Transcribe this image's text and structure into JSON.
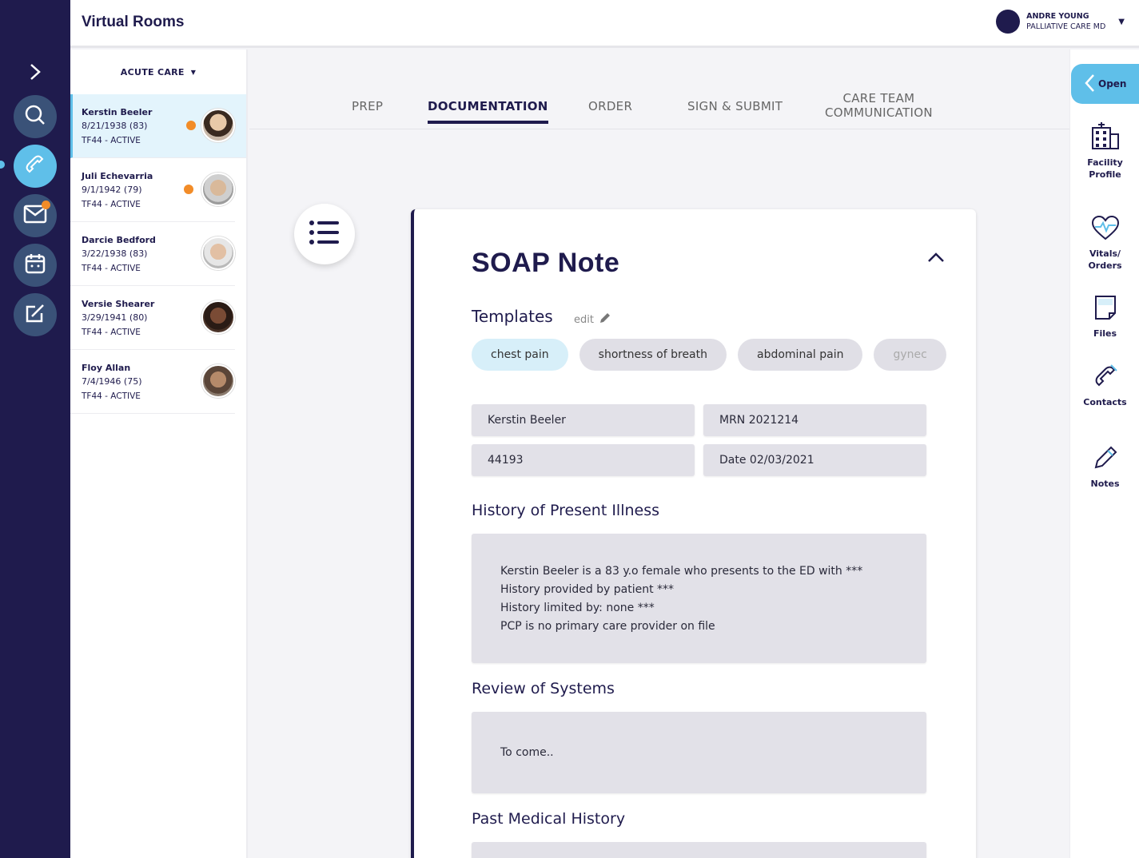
{
  "app": {
    "title": "Virtual Rooms"
  },
  "user": {
    "name": "ANDRE YOUNG",
    "role": "PALLIATIVE CARE MD"
  },
  "rail": {
    "icons": [
      "chevron-right-icon",
      "search-icon",
      "phone-icon",
      "mail-icon",
      "calendar-icon",
      "edit-icon"
    ]
  },
  "patient_list": {
    "filter_label": "ACUTE CARE",
    "patients": [
      {
        "name": "Kerstin Beeler",
        "dob": "8/21/1938 (83)",
        "status": "TF44 - ACTIVE"
      },
      {
        "name": "Juli Echevarria",
        "dob": "9/1/1942 (79)",
        "status": "TF44 - ACTIVE"
      },
      {
        "name": "Darcie Bedford",
        "dob": "3/22/1938 (83)",
        "status": "TF44 - ACTIVE"
      },
      {
        "name": "Versie Shearer",
        "dob": "3/29/1941 (80)",
        "status": "TF44 - ACTIVE"
      },
      {
        "name": "Floy Allan",
        "dob": "7/4/1946 (75)",
        "status": "TF44 - ACTIVE"
      }
    ]
  },
  "tabs": [
    {
      "label": "PREP"
    },
    {
      "label": "DOCUMENTATION"
    },
    {
      "label": "ORDER"
    },
    {
      "label": "SIGN & SUBMIT"
    },
    {
      "label_line1": "CARE TEAM",
      "label_line2": "COMMUNICATION"
    }
  ],
  "soap": {
    "title": "SOAP Note",
    "templates_label": "Templates",
    "edit_label": "edit",
    "templates": [
      "chest pain",
      "shortness of breath",
      "abdominal pain",
      "gynec"
    ],
    "fields": {
      "patient_name": "Kerstin Beeler",
      "mrn": "MRN 2021214",
      "zip": "44193",
      "date": "Date 02/03/2021"
    },
    "hpi_title": "History of Present Illness",
    "hpi_lines": [
      "Kerstin Beeler is a 83 y.o female who presents to the ED with ***",
      "History provided by patient ***",
      "History limited by: none ***",
      "PCP is no primary care provider on file"
    ],
    "ros_title": "Review of Systems",
    "ros_text": "To come..",
    "pmh_title": "Past Medical History"
  },
  "right_sidebar": {
    "open_label": "Open",
    "items": [
      {
        "label": "Facility\nProfile",
        "icon": "building-icon"
      },
      {
        "label": "Vitals/\nOrders",
        "icon": "heart-pulse-icon"
      },
      {
        "label": "Files",
        "icon": "file-icon"
      },
      {
        "label": "Contacts",
        "icon": "phone-icon"
      },
      {
        "label": "Notes",
        "icon": "pencil-icon"
      }
    ]
  },
  "colors": {
    "navy": "#1f1b4d",
    "accent": "#5fbfe9",
    "alert": "#f28c28"
  }
}
